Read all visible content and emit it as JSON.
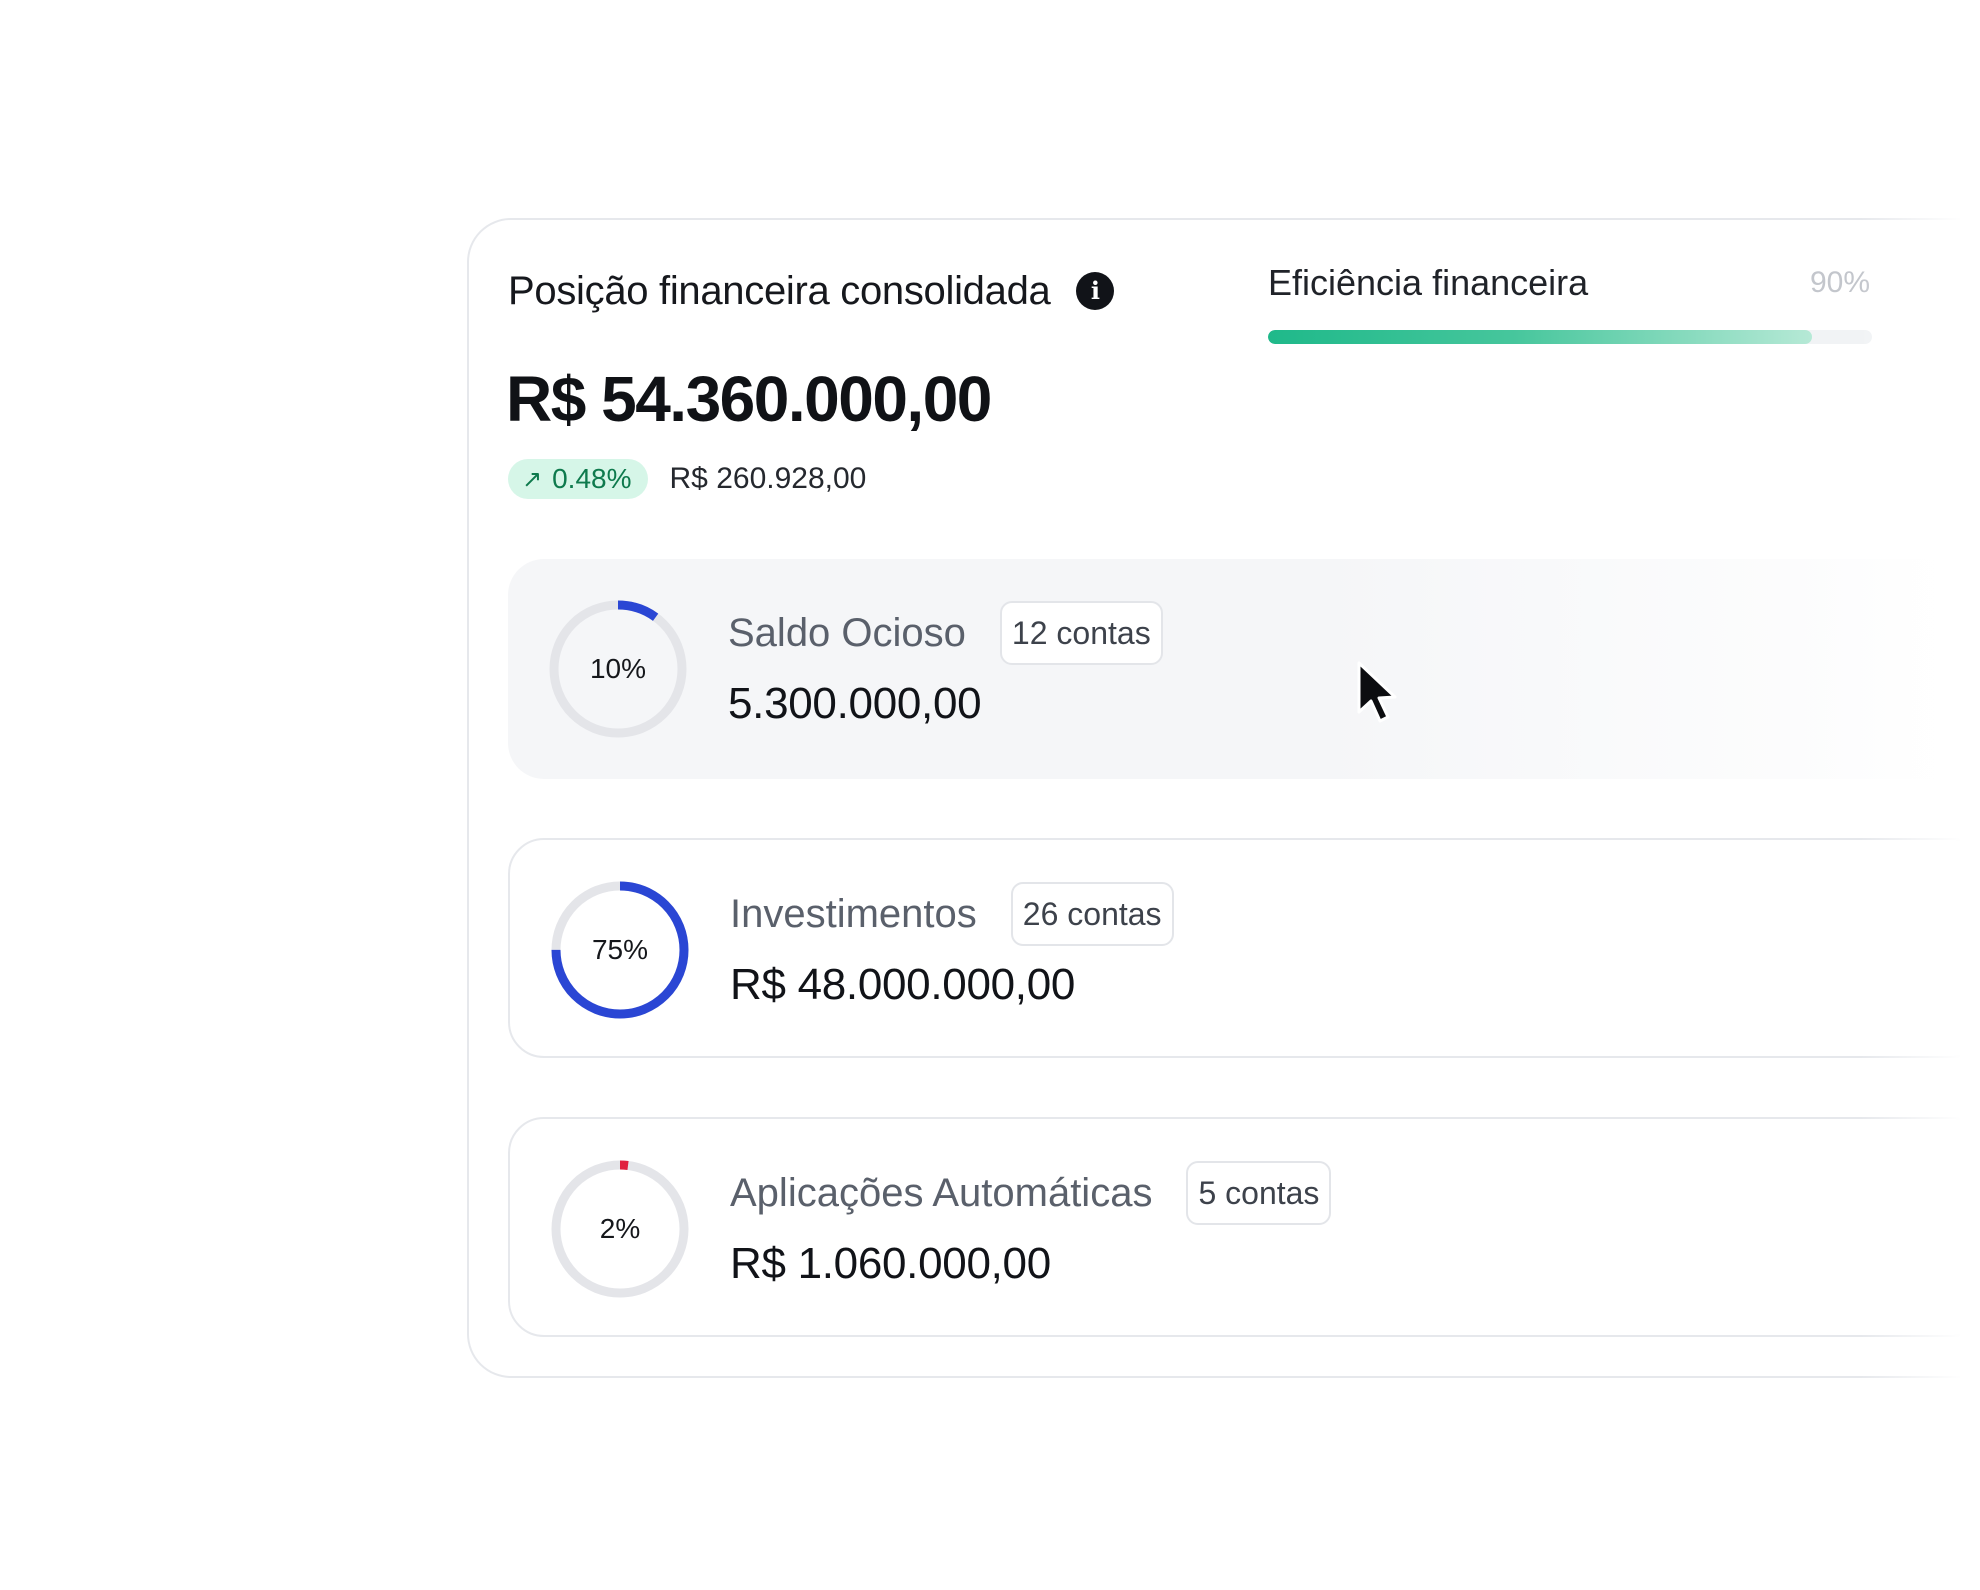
{
  "summary": {
    "title": "Posição financeira consolidada",
    "info_icon": "info-icon",
    "total": "R$ 54.360.000,00",
    "change_percent": "0.48%",
    "change_arrow": "↗",
    "change_amount": "R$ 260.928,00",
    "change_color": "#0e7a4d"
  },
  "efficiency": {
    "label": "Eficiência financeira",
    "percent_text": "90%",
    "value": 0.9,
    "bar_color": "#1fb98a"
  },
  "categories": [
    {
      "name": "Saldo Ocioso",
      "accounts": "12 contas",
      "value": "5.300.000,00",
      "percent_text": "10%",
      "percent": 10,
      "ring_color": "#2a46d4",
      "highlighted": true
    },
    {
      "name": "Investimentos",
      "accounts": "26 contas",
      "value": "R$ 48.000.000,00",
      "percent_text": "75%",
      "percent": 75,
      "ring_color": "#2a46d4",
      "highlighted": false
    },
    {
      "name": "Aplicações Automáticas",
      "accounts": "5 contas",
      "value": "R$ 1.060.000,00",
      "percent_text": "2%",
      "percent": 2,
      "ring_color": "#e0213f",
      "highlighted": false
    }
  ],
  "cursor_icon": "mouse-pointer-icon"
}
